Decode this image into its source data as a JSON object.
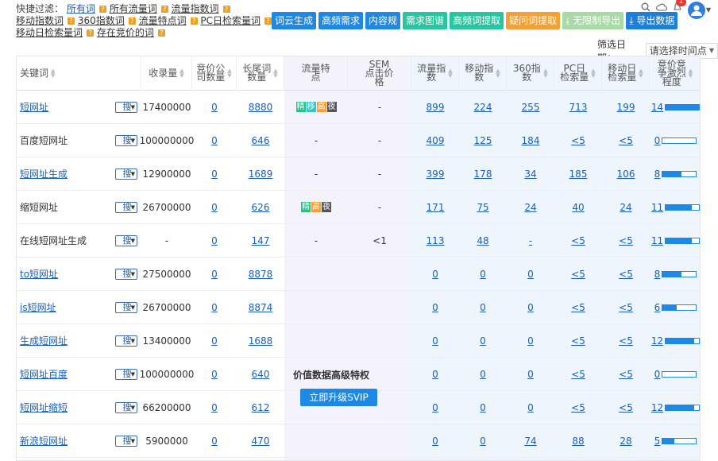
{
  "filter": {
    "label": "快捷过滤：",
    "items": [
      {
        "label": "所有词",
        "active": true
      },
      {
        "label": "所有流量词",
        "active": false
      },
      {
        "label": "流量指数词",
        "active": false
      },
      {
        "label": "移动指数词",
        "active": false
      },
      {
        "label": "360指数词",
        "active": false
      },
      {
        "label": "流量特点词",
        "active": false
      },
      {
        "label": "PC日检索量词",
        "active": false
      },
      {
        "label": "移动日检索量词",
        "active": false
      },
      {
        "label": "存在竞价的词",
        "active": false
      }
    ],
    "help_icon": "?"
  },
  "toolbar": {
    "buttons": [
      {
        "label": "词云生成",
        "color": "#1e88e5"
      },
      {
        "label": "高频需求",
        "color": "#1e88e5"
      },
      {
        "label": "内容规",
        "color": "#1e88e5"
      },
      {
        "label": "需求图谱",
        "color": "#26c6a0"
      },
      {
        "label": "高频词提取",
        "color": "#26c6a0"
      },
      {
        "label": "疑问词提取",
        "color": "#f5a034"
      },
      {
        "label": "⤓ 无限制导出",
        "color": "#a9d9a4"
      },
      {
        "label": "⤓ 导出数据",
        "color": "#1e7fd9"
      }
    ]
  },
  "top_icons": {
    "search": "search-icon",
    "cloud": "cloud-icon",
    "bell": "bell-icon",
    "bell_count": "1",
    "avatar": "user-avatar-icon"
  },
  "date_filter": {
    "label": "筛选日期：",
    "placeholder": "请选择时间点"
  },
  "columns": [
    "关键词",
    "收录量",
    "竞价公司数量",
    "长尾词数量",
    "流量特点",
    "SEM点击价格",
    "流量指数",
    "移动指数",
    "360指数",
    "PC日检索量",
    "移动日检索量",
    "竞价竞争激烈程度"
  ],
  "rows": [
    {
      "keyword": "短网址",
      "kw_link": true,
      "search_chip": "搜",
      "indexed": "17400000",
      "bid_companies": "0",
      "longtail": "8880",
      "traffic_tags": [
        "精",
        "移",
        "高",
        "夜"
      ],
      "sem_price": "-",
      "flow_index": "899",
      "mobile_index": "224",
      "idx360": "255",
      "pc_daily": "713",
      "mobile_daily": "199",
      "competition": "14",
      "competition_frac": 1.0
    },
    {
      "keyword": "百度短网址",
      "kw_link": false,
      "search_chip": "搜",
      "indexed": "100000000",
      "bid_companies": "0",
      "longtail": "646",
      "traffic_tags": [],
      "traffic_text": "-",
      "sem_price": "-",
      "flow_index": "409",
      "mobile_index": "125",
      "idx360": "184",
      "pc_daily": "<5",
      "mobile_daily": "<5",
      "competition": "0",
      "competition_frac": 0.0
    },
    {
      "keyword": "短网址生成",
      "kw_link": true,
      "search_chip": "搜",
      "indexed": "12900000",
      "bid_companies": "0",
      "longtail": "1689",
      "traffic_tags": [],
      "traffic_text": "-",
      "sem_price": "-",
      "flow_index": "399",
      "mobile_index": "178",
      "idx360": "34",
      "pc_daily": "185",
      "mobile_daily": "106",
      "competition": "8",
      "competition_frac": 0.57
    },
    {
      "keyword": "缩短网址",
      "kw_link": false,
      "search_chip": "搜",
      "indexed": "26700000",
      "bid_companies": "0",
      "longtail": "626",
      "traffic_tags": [
        "精",
        "高",
        "夜"
      ],
      "sem_price": "-",
      "flow_index": "171",
      "mobile_index": "75",
      "idx360": "24",
      "pc_daily": "40",
      "mobile_daily": "24",
      "competition": "11",
      "competition_frac": 0.79
    },
    {
      "keyword": "在线短网址生成",
      "kw_link": false,
      "search_chip": "搜",
      "indexed": "-",
      "bid_companies": "0",
      "longtail": "147",
      "traffic_tags": [],
      "traffic_text": "-",
      "sem_price": "<1",
      "flow_index": "113",
      "mobile_index": "48",
      "idx360": "-",
      "pc_daily": "<5",
      "mobile_daily": "<5",
      "competition": "11",
      "competition_frac": 0.79
    },
    {
      "keyword": "to短网址",
      "kw_link": true,
      "search_chip": "搜",
      "indexed": "27500000",
      "bid_companies": "0",
      "longtail": "8878",
      "traffic_tags": [],
      "traffic_text": "",
      "sem_price": "",
      "flow_index": "0",
      "mobile_index": "0",
      "idx360": "0",
      "pc_daily": "<5",
      "mobile_daily": "<5",
      "competition": "8",
      "competition_frac": 0.57
    },
    {
      "keyword": "is短网址",
      "kw_link": true,
      "search_chip": "搜",
      "indexed": "26700000",
      "bid_companies": "0",
      "longtail": "8874",
      "traffic_tags": [],
      "traffic_text": "",
      "sem_price": "",
      "flow_index": "0",
      "mobile_index": "0",
      "idx360": "0",
      "pc_daily": "<5",
      "mobile_daily": "<5",
      "competition": "6",
      "competition_frac": 0.43
    },
    {
      "keyword": "生成短网址",
      "kw_link": true,
      "search_chip": "搜",
      "indexed": "13400000",
      "bid_companies": "0",
      "longtail": "1688",
      "traffic_tags": [],
      "traffic_text": "",
      "sem_price": "",
      "flow_index": "0",
      "mobile_index": "0",
      "idx360": "0",
      "pc_daily": "<5",
      "mobile_daily": "<5",
      "competition": "12",
      "competition_frac": 0.86
    },
    {
      "keyword": "短网址百度",
      "kw_link": true,
      "search_chip": "搜",
      "indexed": "100000000",
      "bid_companies": "0",
      "longtail": "640",
      "traffic_tags": [],
      "traffic_text": "",
      "sem_price": "",
      "flow_index": "0",
      "mobile_index": "0",
      "idx360": "0",
      "pc_daily": "<5",
      "mobile_daily": "<5",
      "competition": "0",
      "competition_frac": 0.0
    },
    {
      "keyword": "短网址缩短",
      "kw_link": true,
      "search_chip": "搜",
      "indexed": "66200000",
      "bid_companies": "0",
      "longtail": "612",
      "traffic_tags": [],
      "traffic_text": "",
      "sem_price": "",
      "flow_index": "0",
      "mobile_index": "0",
      "idx360": "0",
      "pc_daily": "<5",
      "mobile_daily": "<5",
      "competition": "12",
      "competition_frac": 0.86
    },
    {
      "keyword": "新浪短网址",
      "kw_link": true,
      "search_chip": "搜",
      "indexed": "5900000",
      "bid_companies": "0",
      "longtail": "470",
      "traffic_tags": [],
      "traffic_text": "",
      "sem_price": "",
      "flow_index": "0",
      "mobile_index": "0",
      "idx360": "74",
      "pc_daily": "88",
      "mobile_daily": "28",
      "competition": "5",
      "competition_frac": 0.36
    }
  ],
  "promo": {
    "text": "价值数据高级特权",
    "button": "立即升级SVIP"
  }
}
